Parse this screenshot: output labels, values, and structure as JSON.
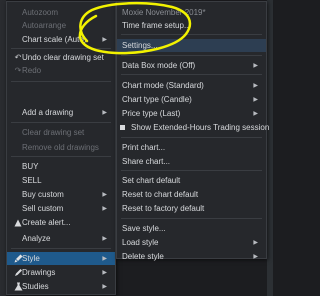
{
  "left_menu": {
    "items": [
      {
        "label": "Autozoom",
        "disabled": true
      },
      {
        "label": "Autoarrange",
        "disabled": true
      },
      {
        "label": "Chart scale (Auto)",
        "arrow": true
      },
      {
        "label": "Undo clear drawing set",
        "icon": "undo-icon"
      },
      {
        "label": "Redo",
        "icon": "redo-icon",
        "disabled": true
      },
      {
        "label": "Add a drawing",
        "arrow": true
      },
      {
        "label": "Clear drawing set",
        "disabled": true
      },
      {
        "label": "Remove old drawings",
        "disabled": true
      },
      {
        "label": "BUY"
      },
      {
        "label": "SELL"
      },
      {
        "label": "Buy custom",
        "arrow": true
      },
      {
        "label": "Sell custom",
        "arrow": true
      },
      {
        "label": "Create alert...",
        "icon": "alert-icon"
      },
      {
        "label": "Analyze",
        "arrow": true
      },
      {
        "label": "Style",
        "icon": "paint-icon",
        "arrow": true
      },
      {
        "label": "Drawings",
        "icon": "pencil-icon",
        "arrow": true
      },
      {
        "label": "Studies",
        "icon": "flask-icon",
        "arrow": true
      }
    ]
  },
  "right_menu": {
    "header": "Moxie November 2019*",
    "items": [
      {
        "label": "Time frame setup..."
      },
      {
        "label": "Settings..."
      },
      {
        "label": "Data Box mode (Off)",
        "arrow": true
      },
      {
        "label": "Chart mode (Standard)",
        "arrow": true
      },
      {
        "label": "Chart type (Candle)",
        "arrow": true
      },
      {
        "label": "Price type (Last)",
        "arrow": true
      },
      {
        "label": "Show Extended-Hours Trading session",
        "checkbox": true
      },
      {
        "label": "Print chart..."
      },
      {
        "label": "Share chart..."
      },
      {
        "label": "Set chart default"
      },
      {
        "label": "Reset to chart default"
      },
      {
        "label": "Reset to factory default"
      },
      {
        "label": "Save style..."
      },
      {
        "label": "Load style",
        "arrow": true
      },
      {
        "label": "Delete style",
        "arrow": true
      }
    ]
  },
  "colors": {
    "menu_bg": "#26282c",
    "highlight": "#1f5a8c",
    "annotation": "#f2f200"
  }
}
